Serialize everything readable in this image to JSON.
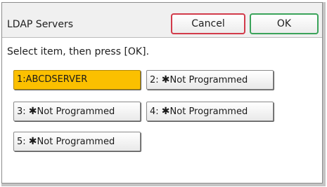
{
  "dialog": {
    "title": "LDAP Servers",
    "cancel_label": "Cancel",
    "ok_label": "OK",
    "instruction": "Select item, then press [OK]."
  },
  "items": [
    {
      "prefix": "1:",
      "star": "",
      "label": "ABCDSERVER",
      "selected": true
    },
    {
      "prefix": "2:",
      "star": "✱",
      "label": "Not Programmed",
      "selected": false
    },
    {
      "prefix": "3:",
      "star": "✱",
      "label": "Not Programmed",
      "selected": false
    },
    {
      "prefix": "4:",
      "star": "✱",
      "label": "Not Programmed",
      "selected": false
    },
    {
      "prefix": "5:",
      "star": "✱",
      "label": "Not Programmed",
      "selected": false
    }
  ],
  "colors": {
    "selected_item": "#fbc000",
    "cancel_border": "#d23a4a",
    "ok_border": "#3aa35a"
  }
}
